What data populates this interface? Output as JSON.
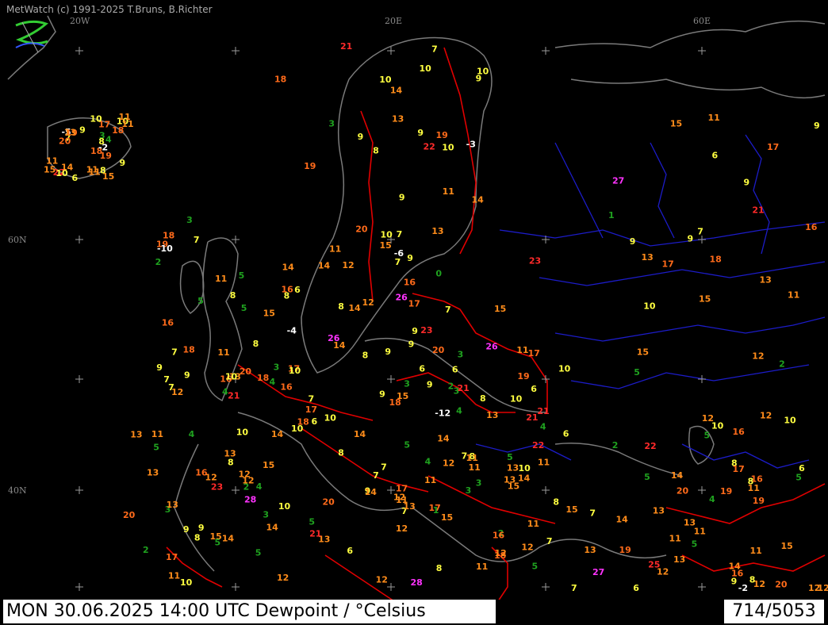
{
  "app": {
    "credit": "MetWatch  (c) 1991-2025 T.Bruns, B.Richter",
    "logo_icon": "metwatch-logo-icon"
  },
  "map": {
    "grid_labels": {
      "lon_20w": "20W",
      "lon_20e": "20E",
      "lon_60e": "60E",
      "lat_60n": "60N",
      "lat_40n": "40N"
    },
    "colors": {
      "background": "#000000",
      "coastline": "#7a7a7a",
      "country_border": "#e00000",
      "region_border": "#1c1cc8",
      "grid_cross": "#9a9a9a"
    }
  },
  "legend_scale": {
    "neg": "#ffffff",
    "c0_5": "#1fa11f",
    "c6_10": "#ffff40",
    "c11_15": "#ff8c1a",
    "c16_20": "#ff6a1a",
    "c21_25": "#ff2a2a",
    "c26_plus": "#ff33ff"
  },
  "footer": {
    "title": "MON 30.06.2025 14:00 UTC    Dewpoint / °Celsius",
    "station_count": "714/5053"
  },
  "observations": [
    {
      "v": 3
    },
    {
      "v": 9
    },
    {
      "v": 9
    },
    {
      "v": 7
    },
    {
      "v": 7
    },
    {
      "v": 6
    },
    {
      "v": 8
    },
    {
      "v": 7
    },
    {
      "v": 5
    },
    {
      "v": 2
    },
    {
      "v": 4
    },
    {
      "v": 4
    },
    {
      "v": 3
    },
    {
      "v": 3
    },
    {
      "v": 5
    },
    {
      "v": 3
    },
    {
      "v": 2
    },
    {
      "v": 3
    },
    {
      "v": 2
    },
    {
      "v": 5
    },
    {
      "v": 5
    },
    {
      "v": 6
    },
    {
      "v": 11
    },
    {
      "v": 10
    },
    {
      "v": 7
    },
    {
      "v": 8
    },
    {
      "v": 9
    },
    {
      "v": 8
    },
    {
      "v": 11
    },
    {
      "v": 9
    },
    {
      "v": 11
    },
    {
      "v": 11
    },
    {
      "v": 8
    },
    {
      "v": 9
    },
    {
      "v": 10
    },
    {
      "v": 9
    },
    {
      "v": 11
    },
    {
      "v": 10
    },
    {
      "v": 13
    },
    {
      "v": 12
    },
    {
      "v": 12
    },
    {
      "v": 11
    },
    {
      "v": 11
    },
    {
      "v": 11
    },
    {
      "v": 8
    },
    {
      "v": 11
    },
    {
      "v": 14
    },
    {
      "v": 15
    },
    {
      "v": 14
    },
    {
      "v": 10
    },
    {
      "v": 8
    },
    {
      "v": 12
    },
    {
      "v": 13
    },
    {
      "v": 15
    },
    {
      "v": 16
    },
    {
      "v": 14
    },
    {
      "v": 9
    },
    {
      "v": 16
    },
    {
      "v": 13
    },
    {
      "v": 17
    },
    {
      "v": 13
    },
    {
      "v": 11
    },
    {
      "v": 13
    },
    {
      "v": 19
    },
    {
      "v": 18
    },
    {
      "v": 20
    },
    {
      "v": 17
    },
    {
      "v": 14
    },
    {
      "v": 17
    },
    {
      "v": 18
    },
    {
      "v": 17
    },
    {
      "v": 21
    },
    {
      "v": 20
    },
    {
      "v": 18
    },
    {
      "v": 27
    },
    {
      "v": 21
    },
    {
      "v": 19
    },
    {
      "v": 22
    },
    {
      "v": 21
    },
    {
      "v": 26
    },
    {
      "v": 19
    },
    {
      "v": 18
    },
    {
      "v": 22
    },
    {
      "v": 23
    },
    {
      "v": 21
    },
    {
      "v": 20
    },
    {
      "v": 19
    },
    {
      "v": -2
    },
    {
      "v": -5
    },
    {
      "v": -6
    },
    {
      "v": 26
    },
    {
      "v": 9
    },
    {
      "v": 10
    },
    {
      "v": 21
    },
    {
      "v": 15
    },
    {
      "v": 20
    },
    {
      "v": 22
    },
    {
      "v": 23
    },
    {
      "v": 16
    },
    {
      "v": 19
    },
    {
      "v": 13
    },
    {
      "v": 12
    },
    {
      "v": 11
    },
    {
      "v": 11
    },
    {
      "v": 10
    },
    {
      "v": 12
    },
    {
      "v": 14
    },
    {
      "v": 7
    },
    {
      "v": 9
    },
    {
      "v": 8
    },
    {
      "v": 10
    },
    {
      "v": 11
    },
    {
      "v": 6
    },
    {
      "v": 5
    },
    {
      "v": 7
    },
    {
      "v": 8
    },
    {
      "v": 9
    },
    {
      "v": 12
    },
    {
      "v": 13
    },
    {
      "v": 15
    },
    {
      "v": 14
    },
    {
      "v": 15
    },
    {
      "v": 10
    },
    {
      "v": 14
    },
    {
      "v": 12
    },
    {
      "v": 15
    },
    {
      "v": 11
    },
    {
      "v": 14
    },
    {
      "v": 17
    },
    {
      "v": 12
    },
    {
      "v": 9
    },
    {
      "v": 10
    },
    {
      "v": 7
    },
    {
      "v": 8
    },
    {
      "v": 6
    },
    {
      "v": 4
    },
    {
      "v": 3
    },
    {
      "v": 7
    },
    {
      "v": 9
    },
    {
      "v": 11
    },
    {
      "v": 13
    },
    {
      "v": 15
    },
    {
      "v": 16
    },
    {
      "v": 18
    },
    {
      "v": 19
    },
    {
      "v": 17
    },
    {
      "v": 20
    },
    {
      "v": 16
    },
    {
      "v": 14
    },
    {
      "v": 13
    },
    {
      "v": 12
    },
    {
      "v": 13
    },
    {
      "v": 17
    },
    {
      "v": 15
    },
    {
      "v": 19
    },
    {
      "v": 18
    },
    {
      "v": 7
    },
    {
      "v": 3
    },
    {
      "v": 4
    },
    {
      "v": 4
    },
    {
      "v": 5
    },
    {
      "v": 8
    },
    {
      "v": 5
    },
    {
      "v": 6
    },
    {
      "v": 5
    },
    {
      "v": -2
    },
    {
      "v": -3
    },
    {
      "v": -4
    },
    {
      "v": -10
    },
    {
      "v": -12
    },
    {
      "v": 26
    },
    {
      "v": 28
    },
    {
      "v": 28
    },
    {
      "v": 25
    },
    {
      "v": 27
    },
    {
      "v": 10
    },
    {
      "v": 15
    },
    {
      "v": 20
    },
    {
      "v": 16
    },
    {
      "v": 18
    },
    {
      "v": 14
    },
    {
      "v": 11
    },
    {
      "v": 13
    },
    {
      "v": 10
    },
    {
      "v": 15
    },
    {
      "v": 17
    },
    {
      "v": 12
    },
    {
      "v": 11
    },
    {
      "v": 9
    },
    {
      "v": 14
    },
    {
      "v": 7
    },
    {
      "v": 5
    },
    {
      "v": 4
    },
    {
      "v": 2
    },
    {
      "v": 3
    },
    {
      "v": 8
    },
    {
      "v": 9
    },
    {
      "v": 12
    },
    {
      "v": 10
    },
    {
      "v": 15
    },
    {
      "v": 0
    },
    {
      "v": 2
    },
    {
      "v": 4
    },
    {
      "v": 3
    },
    {
      "v": 5
    },
    {
      "v": 6
    },
    {
      "v": 7
    },
    {
      "v": 10
    },
    {
      "v": 12
    },
    {
      "v": 11
    },
    {
      "v": 13
    },
    {
      "v": 14
    },
    {
      "v": 16
    },
    {
      "v": 18
    },
    {
      "v": 21
    },
    {
      "v": 17
    },
    {
      "v": 16
    },
    {
      "v": 15
    },
    {
      "v": 13
    },
    {
      "v": 12
    },
    {
      "v": 11
    },
    {
      "v": 9
    },
    {
      "v": 8
    },
    {
      "v": 7
    },
    {
      "v": 10
    },
    {
      "v": 12
    },
    {
      "v": 13
    },
    {
      "v": 15
    },
    {
      "v": 14
    },
    {
      "v": 16
    },
    {
      "v": 19
    },
    {
      "v": 20
    },
    {
      "v": 22
    },
    {
      "v": 23
    },
    {
      "v": 21
    },
    {
      "v": 18
    },
    {
      "v": 17
    },
    {
      "v": 16
    },
    {
      "v": 14
    },
    {
      "v": 13
    },
    {
      "v": 12
    },
    {
      "v": 11
    },
    {
      "v": 10
    },
    {
      "v": 9
    },
    {
      "v": 8
    },
    {
      "v": 7
    },
    {
      "v": 6
    },
    {
      "v": 5
    },
    {
      "v": 4
    },
    {
      "v": 3
    },
    {
      "v": 2
    },
    {
      "v": 1
    },
    {
      "v": 5
    },
    {
      "v": 6
    },
    {
      "v": 7
    },
    {
      "v": 8
    },
    {
      "v": 9
    },
    {
      "v": 10
    },
    {
      "v": 11
    },
    {
      "v": 12
    },
    {
      "v": 13
    },
    {
      "v": 14
    },
    {
      "v": 15
    },
    {
      "v": 17
    },
    {
      "v": 18
    },
    {
      "v": 19
    },
    {
      "v": 20
    },
    {
      "v": 16
    },
    {
      "v": 15
    },
    {
      "v": 14
    },
    {
      "v": 13
    },
    {
      "v": 12
    },
    {
      "v": 11
    },
    {
      "v": 10
    },
    {
      "v": 9
    },
    {
      "v": 8
    },
    {
      "v": 7
    },
    {
      "v": 6
    },
    {
      "v": 5
    },
    {
      "v": 4
    },
    {
      "v": 3
    },
    {
      "v": 2
    },
    {
      "v": 1
    },
    {
      "v": 7
    },
    {
      "v": 9
    },
    {
      "v": 11
    },
    {
      "v": 13
    },
    {
      "v": 14
    },
    {
      "v": 12
    },
    {
      "v": 10
    },
    {
      "v": 8
    },
    {
      "v": 9
    },
    {
      "v": 10
    },
    {
      "v": 11
    },
    {
      "v": 12
    },
    {
      "v": 13
    },
    {
      "v": 12
    },
    {
      "v": 11
    },
    {
      "v": 10
    },
    {
      "v": 9
    },
    {
      "v": 8
    },
    {
      "v": 7
    },
    {
      "v": 6
    },
    {
      "v": 5
    },
    {
      "v": 5
    },
    {
      "v": 6
    },
    {
      "v": 7
    },
    {
      "v": 8
    },
    {
      "v": 9
    },
    {
      "v": 10
    }
  ]
}
